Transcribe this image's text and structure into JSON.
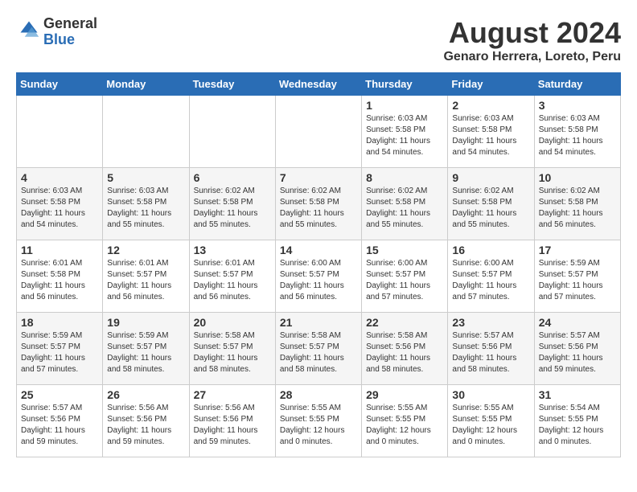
{
  "logo": {
    "general": "General",
    "blue": "Blue"
  },
  "title": "August 2024",
  "location": "Genaro Herrera, Loreto, Peru",
  "weekdays": [
    "Sunday",
    "Monday",
    "Tuesday",
    "Wednesday",
    "Thursday",
    "Friday",
    "Saturday"
  ],
  "weeks": [
    [
      {
        "day": "",
        "info": ""
      },
      {
        "day": "",
        "info": ""
      },
      {
        "day": "",
        "info": ""
      },
      {
        "day": "",
        "info": ""
      },
      {
        "day": "1",
        "info": "Sunrise: 6:03 AM\nSunset: 5:58 PM\nDaylight: 11 hours\nand 54 minutes."
      },
      {
        "day": "2",
        "info": "Sunrise: 6:03 AM\nSunset: 5:58 PM\nDaylight: 11 hours\nand 54 minutes."
      },
      {
        "day": "3",
        "info": "Sunrise: 6:03 AM\nSunset: 5:58 PM\nDaylight: 11 hours\nand 54 minutes."
      }
    ],
    [
      {
        "day": "4",
        "info": "Sunrise: 6:03 AM\nSunset: 5:58 PM\nDaylight: 11 hours\nand 54 minutes."
      },
      {
        "day": "5",
        "info": "Sunrise: 6:03 AM\nSunset: 5:58 PM\nDaylight: 11 hours\nand 55 minutes."
      },
      {
        "day": "6",
        "info": "Sunrise: 6:02 AM\nSunset: 5:58 PM\nDaylight: 11 hours\nand 55 minutes."
      },
      {
        "day": "7",
        "info": "Sunrise: 6:02 AM\nSunset: 5:58 PM\nDaylight: 11 hours\nand 55 minutes."
      },
      {
        "day": "8",
        "info": "Sunrise: 6:02 AM\nSunset: 5:58 PM\nDaylight: 11 hours\nand 55 minutes."
      },
      {
        "day": "9",
        "info": "Sunrise: 6:02 AM\nSunset: 5:58 PM\nDaylight: 11 hours\nand 55 minutes."
      },
      {
        "day": "10",
        "info": "Sunrise: 6:02 AM\nSunset: 5:58 PM\nDaylight: 11 hours\nand 56 minutes."
      }
    ],
    [
      {
        "day": "11",
        "info": "Sunrise: 6:01 AM\nSunset: 5:58 PM\nDaylight: 11 hours\nand 56 minutes."
      },
      {
        "day": "12",
        "info": "Sunrise: 6:01 AM\nSunset: 5:57 PM\nDaylight: 11 hours\nand 56 minutes."
      },
      {
        "day": "13",
        "info": "Sunrise: 6:01 AM\nSunset: 5:57 PM\nDaylight: 11 hours\nand 56 minutes."
      },
      {
        "day": "14",
        "info": "Sunrise: 6:00 AM\nSunset: 5:57 PM\nDaylight: 11 hours\nand 56 minutes."
      },
      {
        "day": "15",
        "info": "Sunrise: 6:00 AM\nSunset: 5:57 PM\nDaylight: 11 hours\nand 57 minutes."
      },
      {
        "day": "16",
        "info": "Sunrise: 6:00 AM\nSunset: 5:57 PM\nDaylight: 11 hours\nand 57 minutes."
      },
      {
        "day": "17",
        "info": "Sunrise: 5:59 AM\nSunset: 5:57 PM\nDaylight: 11 hours\nand 57 minutes."
      }
    ],
    [
      {
        "day": "18",
        "info": "Sunrise: 5:59 AM\nSunset: 5:57 PM\nDaylight: 11 hours\nand 57 minutes."
      },
      {
        "day": "19",
        "info": "Sunrise: 5:59 AM\nSunset: 5:57 PM\nDaylight: 11 hours\nand 58 minutes."
      },
      {
        "day": "20",
        "info": "Sunrise: 5:58 AM\nSunset: 5:57 PM\nDaylight: 11 hours\nand 58 minutes."
      },
      {
        "day": "21",
        "info": "Sunrise: 5:58 AM\nSunset: 5:57 PM\nDaylight: 11 hours\nand 58 minutes."
      },
      {
        "day": "22",
        "info": "Sunrise: 5:58 AM\nSunset: 5:56 PM\nDaylight: 11 hours\nand 58 minutes."
      },
      {
        "day": "23",
        "info": "Sunrise: 5:57 AM\nSunset: 5:56 PM\nDaylight: 11 hours\nand 58 minutes."
      },
      {
        "day": "24",
        "info": "Sunrise: 5:57 AM\nSunset: 5:56 PM\nDaylight: 11 hours\nand 59 minutes."
      }
    ],
    [
      {
        "day": "25",
        "info": "Sunrise: 5:57 AM\nSunset: 5:56 PM\nDaylight: 11 hours\nand 59 minutes."
      },
      {
        "day": "26",
        "info": "Sunrise: 5:56 AM\nSunset: 5:56 PM\nDaylight: 11 hours\nand 59 minutes."
      },
      {
        "day": "27",
        "info": "Sunrise: 5:56 AM\nSunset: 5:56 PM\nDaylight: 11 hours\nand 59 minutes."
      },
      {
        "day": "28",
        "info": "Sunrise: 5:55 AM\nSunset: 5:55 PM\nDaylight: 12 hours\nand 0 minutes."
      },
      {
        "day": "29",
        "info": "Sunrise: 5:55 AM\nSunset: 5:55 PM\nDaylight: 12 hours\nand 0 minutes."
      },
      {
        "day": "30",
        "info": "Sunrise: 5:55 AM\nSunset: 5:55 PM\nDaylight: 12 hours\nand 0 minutes."
      },
      {
        "day": "31",
        "info": "Sunrise: 5:54 AM\nSunset: 5:55 PM\nDaylight: 12 hours\nand 0 minutes."
      }
    ]
  ]
}
